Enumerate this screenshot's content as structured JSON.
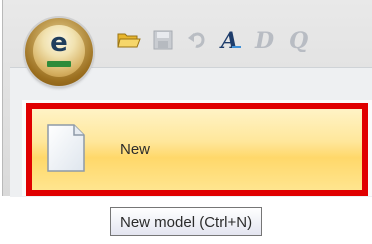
{
  "app_button": {
    "glyph": "e",
    "icon": "app-logo-icon"
  },
  "quick_access_toolbar": {
    "buttons": [
      {
        "icon": "open-folder-icon"
      },
      {
        "icon": "save-icon"
      },
      {
        "icon": "undo-icon"
      },
      {
        "icon": "font-a-icon"
      },
      {
        "icon": "print-preview-icon"
      },
      {
        "icon": "zoom-icon"
      }
    ]
  },
  "menu": {
    "items": [
      {
        "label": "New",
        "icon": "new-document-icon",
        "highlighted": true
      }
    ]
  },
  "tooltip": {
    "text": "New model (Ctrl+N)"
  },
  "colors": {
    "highlight_border": "#e00000",
    "highlight_fill": "#ffe08a",
    "app_green": "#2e8b3a"
  }
}
